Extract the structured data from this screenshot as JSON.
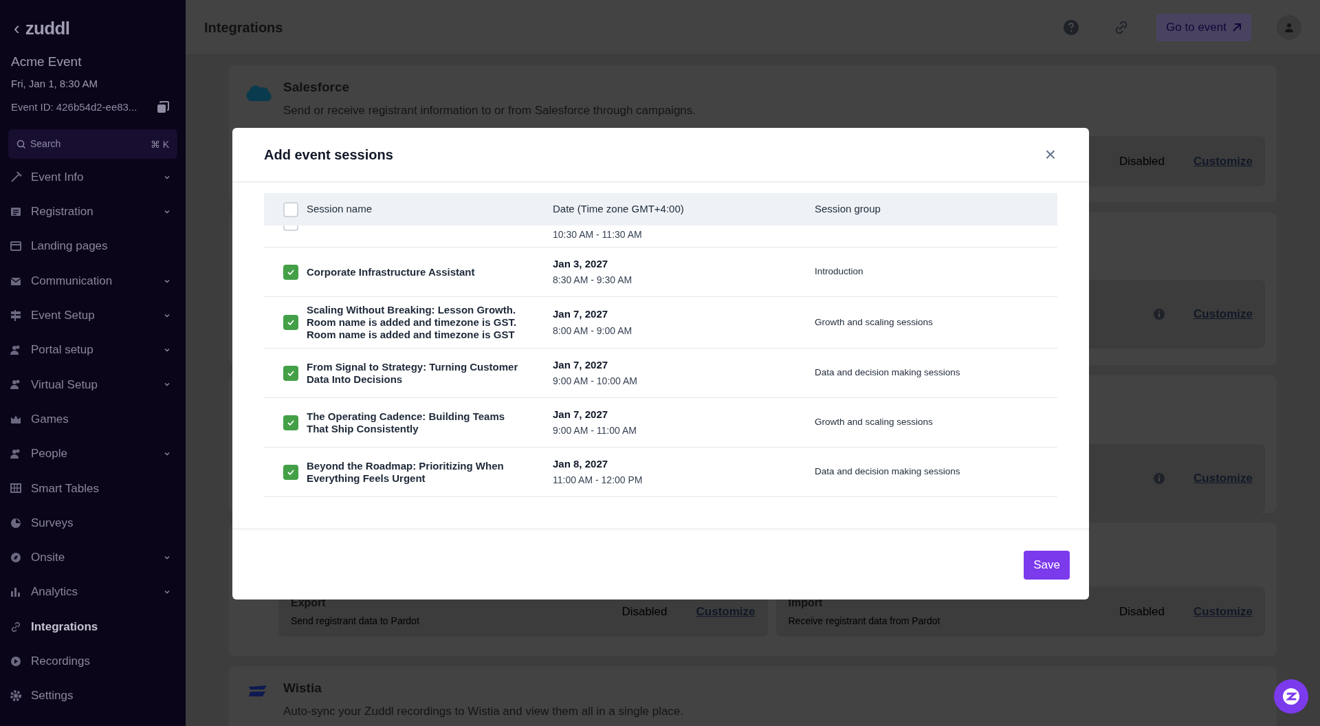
{
  "sidebar": {
    "logo": "zuddl",
    "back": "‹",
    "event_name": "Acme Event",
    "event_date": "Fri, Jan 1, 8:30 AM",
    "event_id": "Event ID: 426b54d2-ee83...",
    "search": {
      "placeholder": "Search",
      "shortcut": "⌘ K"
    },
    "items": [
      {
        "label": "Event Info",
        "expandable": true,
        "selected": false
      },
      {
        "label": "Registration",
        "expandable": true,
        "selected": false
      },
      {
        "label": "Landing pages",
        "expandable": false,
        "selected": false
      },
      {
        "label": "Communication",
        "expandable": true,
        "selected": false
      },
      {
        "label": "Event Setup",
        "expandable": true,
        "selected": false
      },
      {
        "label": "Portal setup",
        "expandable": true,
        "selected": false
      },
      {
        "label": "Virtual Setup",
        "expandable": true,
        "selected": false
      },
      {
        "label": "Games",
        "expandable": false,
        "selected": false
      },
      {
        "label": "People",
        "expandable": true,
        "selected": false
      },
      {
        "label": "Smart Tables",
        "expandable": false,
        "selected": false
      },
      {
        "label": "Surveys",
        "expandable": false,
        "selected": false
      },
      {
        "label": "Onsite",
        "expandable": true,
        "selected": false
      },
      {
        "label": "Analytics",
        "expandable": true,
        "selected": false
      },
      {
        "label": "Integrations",
        "expandable": false,
        "selected": true
      },
      {
        "label": "Recordings",
        "expandable": false,
        "selected": false
      },
      {
        "label": "Settings",
        "expandable": false,
        "selected": false
      }
    ]
  },
  "header": {
    "title": "Integrations",
    "go_to_event": "Go to event"
  },
  "integrations": [
    {
      "kind": "logo",
      "name": "Salesforce",
      "description": "Send or receive registrant information to or from Salesforce through campaigns.",
      "actions": [
        {
          "status": "Disabled",
          "info": false,
          "link": "Customize"
        }
      ]
    },
    {
      "kind": "plain",
      "actions": [
        {
          "info": true,
          "link": "Customize"
        }
      ]
    },
    {
      "kind": "plain",
      "actions": [
        {
          "info": true,
          "link": "Customize"
        }
      ]
    },
    {
      "kind": "split",
      "actions": [
        {
          "title": "Export",
          "description": "Send registrant data to Pardot",
          "status": "Disabled",
          "info": false,
          "link": "Customize"
        },
        {
          "title": "Import",
          "description": "Receive registrant data from Pardot",
          "status": "Disabled",
          "info": false,
          "link": "Customize"
        }
      ]
    },
    {
      "kind": "logo",
      "name": "Wistia",
      "description": "Auto-sync your Zuddl recordings to Wistia and view them all in a single place."
    }
  ],
  "modal": {
    "title": "Add event sessions",
    "close": "×",
    "columns": [
      "Session name",
      "Date (Time zone GMT+4:00)",
      "Session group"
    ],
    "all_checked": false,
    "rows": [
      {
        "checked": false,
        "time": "10:30 AM - 11:30 AM"
      },
      {
        "checked": true,
        "name": "Corporate Infrastructure Assistant",
        "date": "Jan 3, 2027",
        "time": "8:30 AM - 9:30 AM",
        "group": "Introduction"
      },
      {
        "checked": true,
        "name": "Scaling Without Breaking: Lesson Growth. Room name is added and timezone is GST. Room name is added and timezone is GST",
        "date": "Jan 7, 2027",
        "time": "8:00 AM - 9:00 AM",
        "group": "Growth and scaling sessions"
      },
      {
        "checked": true,
        "name": "From Signal to Strategy: Turning Customer Data Into Decisions",
        "date": "Jan 7, 2027",
        "time": "9:00 AM - 10:00 AM",
        "group": "Data and decision making sessions"
      },
      {
        "checked": true,
        "name": "The Operating Cadence: Building Teams That Ship Consistently",
        "date": "Jan 7, 2027",
        "time": "9:00 AM - 11:00 AM",
        "group": "Growth and scaling sessions"
      },
      {
        "checked": true,
        "name": "Beyond the Roadmap: Prioritizing When Everything Feels Urgent",
        "date": "Jan 8, 2027",
        "time": "11:00 AM - 12:00 PM",
        "group": "Data and decision making sessions"
      }
    ],
    "save": "Save"
  }
}
